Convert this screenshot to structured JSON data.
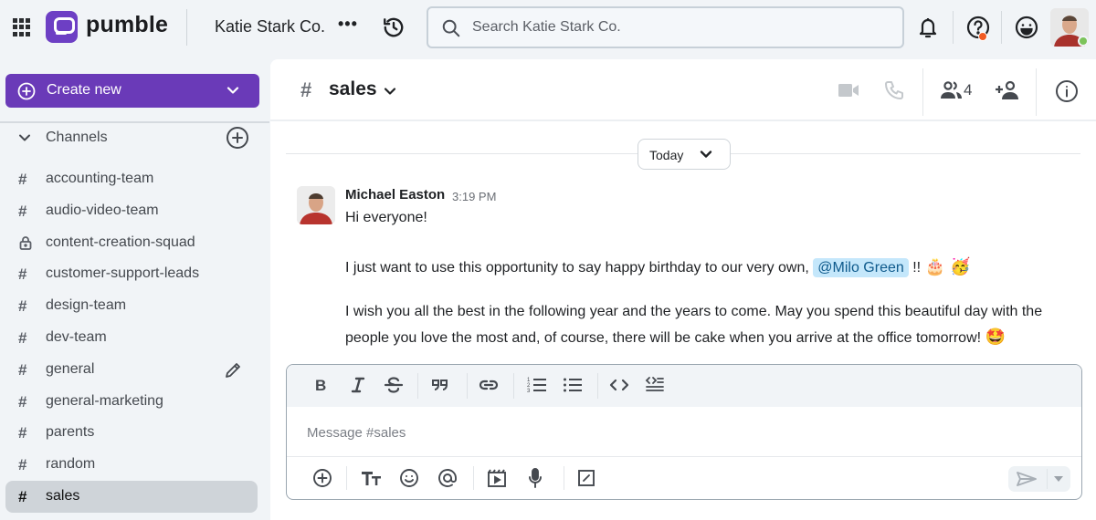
{
  "app": {
    "brand": "pumble",
    "workspace": "Katie Stark Co.",
    "workspace_more": "•••"
  },
  "search": {
    "placeholder": "Search Katie Stark Co."
  },
  "colors": {
    "brand": "#6a3ab8",
    "mention_bg": "#c4e7fb",
    "notification_dot": "#f15a22",
    "online": "#7cc35a"
  },
  "sidebar": {
    "create_new": "Create new",
    "channels_title": "Channels",
    "channels": [
      {
        "name": "accounting-team",
        "icon": "hash"
      },
      {
        "name": "audio-video-team",
        "icon": "hash"
      },
      {
        "name": "content-creation-squad",
        "icon": "lock"
      },
      {
        "name": "customer-support-leads",
        "icon": "hash"
      },
      {
        "name": "design-team",
        "icon": "hash"
      },
      {
        "name": "dev-team",
        "icon": "hash"
      },
      {
        "name": "general",
        "icon": "hash"
      },
      {
        "name": "general-marketing",
        "icon": "hash"
      },
      {
        "name": "parents",
        "icon": "hash"
      },
      {
        "name": "random",
        "icon": "hash"
      },
      {
        "name": "sales",
        "icon": "hash",
        "active": true
      }
    ],
    "hash_glyph": "#"
  },
  "channel": {
    "hash": "#",
    "name": "sales",
    "member_count": "4"
  },
  "date_divider": "Today",
  "message": {
    "author": "Michael Easton",
    "time": "3:19 PM",
    "line1": "Hi everyone!",
    "line2_pre": "I just want to use this opportunity to say happy birthday to our very own,",
    "mention": "@Milo Green",
    "line2_post": "!!",
    "line2_emojis": "🎂 🥳",
    "line3": "I wish you all the best in the following year and the years to come. May you spend this beautiful day with the",
    "line4": "people you love the most and, of course, there will be cake when you arrive at the office tomorrow!",
    "line4_emoji": "🤩"
  },
  "composer": {
    "placeholder": "Message #sales"
  }
}
